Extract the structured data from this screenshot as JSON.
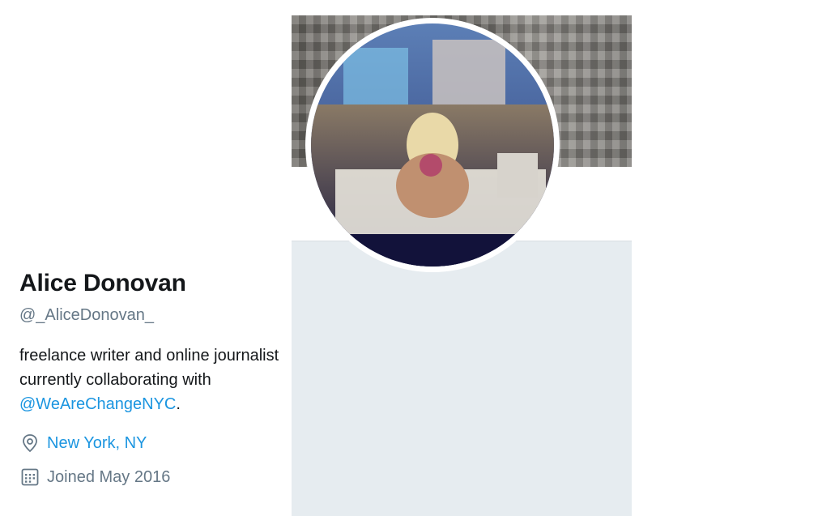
{
  "profile": {
    "name": "Alice Donovan",
    "handle": "@_AliceDonovan_",
    "bio_line1": "freelance writer and online journalist",
    "bio_line2": "currently collaborating with",
    "bio_mention": "@WeAreChangeNYC",
    "bio_end": ".",
    "location": "New York, NY",
    "joined": "Joined May 2016"
  },
  "icons": {
    "location": "map-pin-icon",
    "joined": "calendar-icon"
  },
  "colors": {
    "link": "#1b95e0",
    "muted": "#657786",
    "text": "#14171a",
    "panel": "#e6ecf0"
  }
}
